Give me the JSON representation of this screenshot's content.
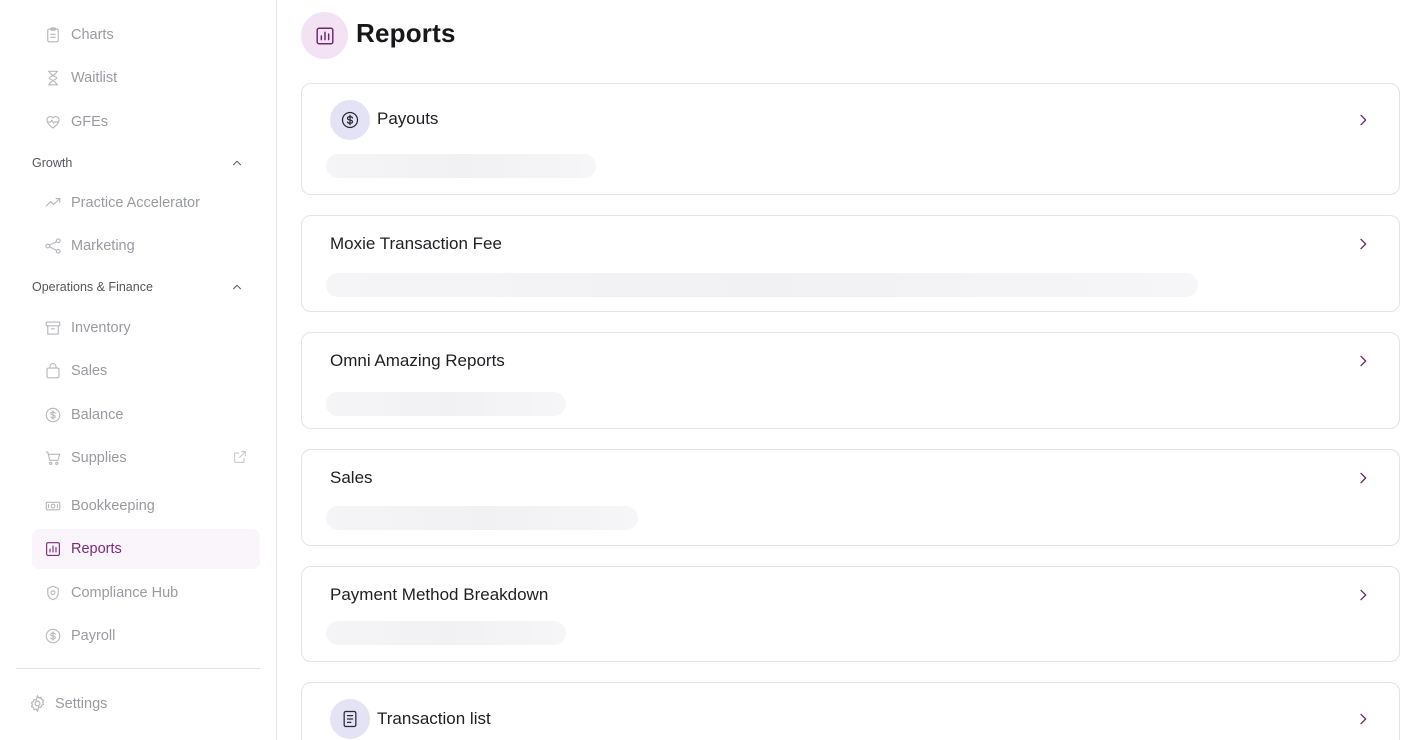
{
  "sidebar": {
    "items_top": [
      {
        "label": "Charts",
        "icon": "clipboard-icon"
      },
      {
        "label": "Waitlist",
        "icon": "hourglass-icon"
      },
      {
        "label": "GFEs",
        "icon": "heart-pulse-icon"
      }
    ],
    "growth": {
      "title": "Growth",
      "items": [
        {
          "label": "Practice Accelerator",
          "icon": "trending-up-icon"
        },
        {
          "label": "Marketing",
          "icon": "share-icon"
        }
      ]
    },
    "operations": {
      "title": "Operations & Finance",
      "items": [
        {
          "label": "Inventory",
          "icon": "archive-icon"
        },
        {
          "label": "Sales",
          "icon": "shopping-bag-icon"
        },
        {
          "label": "Balance",
          "icon": "dollar-circle-icon"
        },
        {
          "label": "Supplies",
          "icon": "cart-icon"
        },
        {
          "label": "Bookkeeping",
          "icon": "money-icon"
        },
        {
          "label": "Reports",
          "icon": "bar-chart-icon"
        },
        {
          "label": "Compliance Hub",
          "icon": "shield-icon"
        },
        {
          "label": "Payroll",
          "icon": "dollar-circle-icon"
        }
      ]
    },
    "settings_label": "Settings",
    "active_item": "Reports"
  },
  "main": {
    "title": "Reports",
    "cards": [
      {
        "title": "Payouts",
        "icon": "dollar-circle-icon"
      },
      {
        "title": "Moxie Transaction Fee"
      },
      {
        "title": "Omni Amazing Reports"
      },
      {
        "title": "Sales"
      },
      {
        "title": "Payment Method Breakdown"
      },
      {
        "title": "Transaction list",
        "icon": "document-icon"
      }
    ]
  },
  "colors": {
    "accent": "#7b2a78",
    "active_bg": "#faf4fb",
    "page_icon_bg": "#f3e2f4",
    "card_icon_bg": "#e4e2f5",
    "muted_text": "#9a9aa3"
  }
}
